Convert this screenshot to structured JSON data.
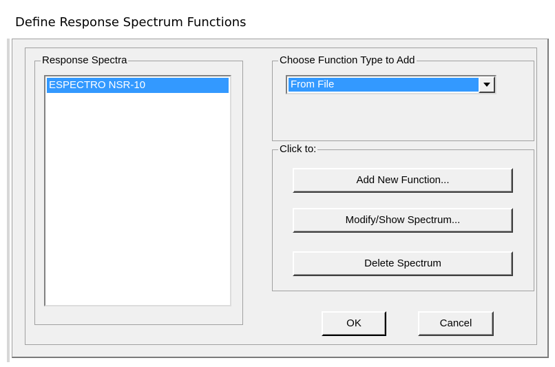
{
  "window": {
    "title": "Define Response Spectrum Functions"
  },
  "response_spectra": {
    "legend": "Response Spectra",
    "items": [
      "ESPECTRO NSR-10"
    ],
    "selected_index": 0
  },
  "function_type": {
    "legend": "Choose  Function Type to Add",
    "selected": "From File"
  },
  "click_to": {
    "legend": "Click to:",
    "add_label": "Add New Function...",
    "modify_label": "Modify/Show Spectrum...",
    "delete_label": "Delete Spectrum"
  },
  "buttons": {
    "ok": "OK",
    "cancel": "Cancel"
  },
  "colors": {
    "selection": "#3399ff",
    "dialog_bg": "#f0f0f0"
  }
}
